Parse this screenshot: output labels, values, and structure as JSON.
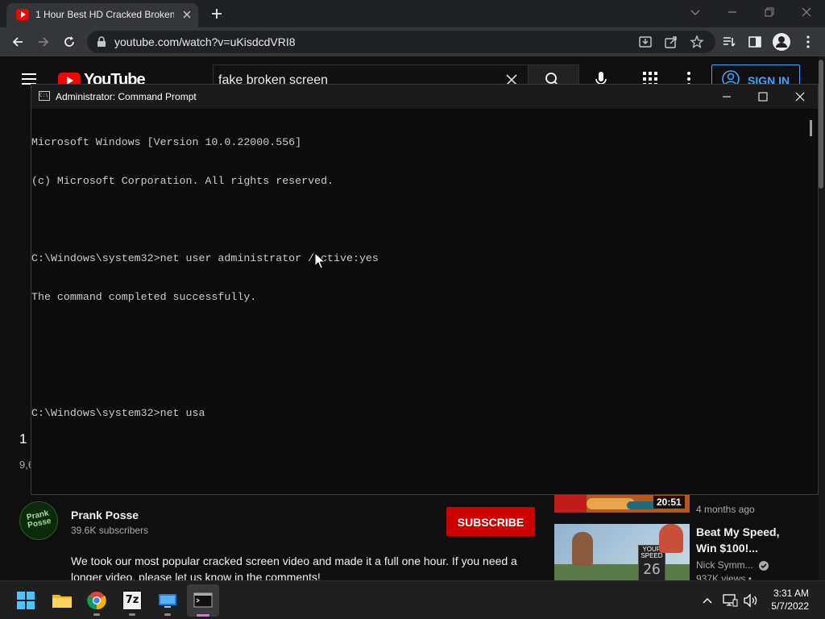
{
  "browser": {
    "tab_title": "1 Hour Best HD Cracked Broken",
    "url": "youtube.com/watch?v=uKisdcdVRI8"
  },
  "youtube": {
    "logo_text": "YouTube",
    "search_value": "fake broken screen",
    "signin_label": "SIGN IN",
    "left_number": "1",
    "left_views": "9,6",
    "channel": {
      "name": "Prank Posse",
      "subscribers": "39.6K subscribers",
      "avatar_text": "Prank Posse",
      "subscribe_label": "SUBSCRIBE"
    },
    "description": "We took our most popular cracked screen video and made it a full one hour. If you need a longer video, please let us know in the comments!",
    "recommendations": [
      {
        "duration": "20:51",
        "meta": "4 months ago"
      },
      {
        "title": "Beat My Speed, Win $100!...",
        "channel": "Nick Symm...",
        "views": "937K views •",
        "thumb_sign_top": "YOUR",
        "thumb_sign_bottom": "SPEED",
        "thumb_number": "26"
      }
    ]
  },
  "cmd": {
    "title": "Administrator: Command Prompt",
    "icon_text": "C:\\",
    "lines": [
      "Microsoft Windows [Version 10.0.22000.556]",
      "(c) Microsoft Corporation. All rights reserved.",
      "",
      "C:\\Windows\\system32>net user administrator /active:yes",
      "The command completed successfully.",
      "",
      "",
      "C:\\Windows\\system32>net usa"
    ]
  },
  "taskbar": {
    "apps": [
      "start-icon",
      "file-explorer-icon",
      "chrome-icon",
      "7zip-icon",
      "remote-desktop-icon",
      "terminal-icon"
    ],
    "sevenzip_label": "7z",
    "time": "3:31 AM",
    "date": "5/7/2022"
  }
}
